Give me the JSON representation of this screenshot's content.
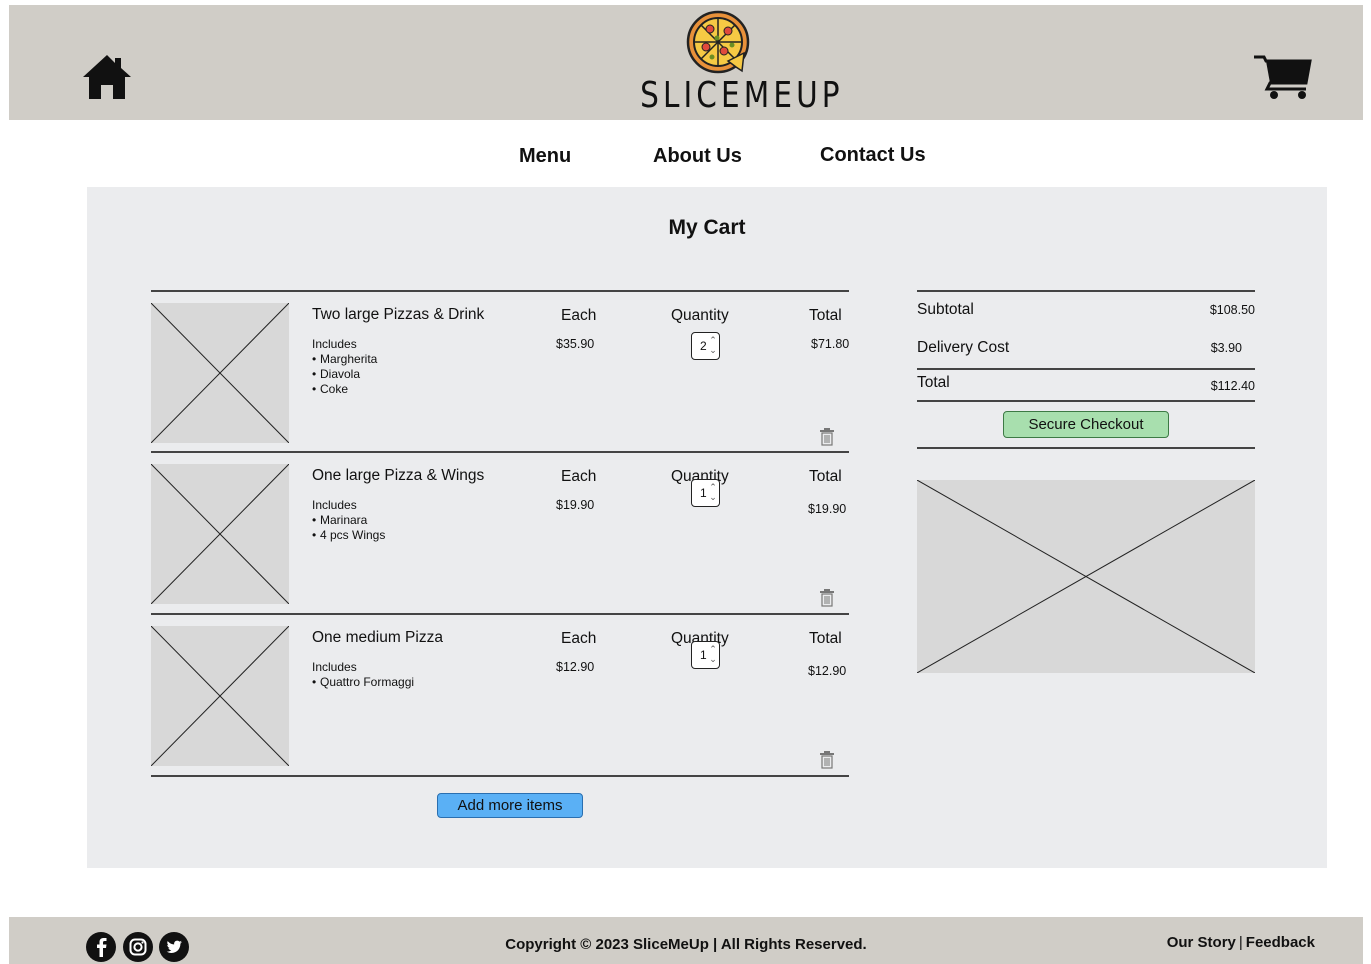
{
  "brand": {
    "name": "SLICEMEUP"
  },
  "header": {
    "home_icon": "home-icon",
    "cart_icon": "shopping-cart-icon"
  },
  "nav": {
    "menu": "Menu",
    "about": "About Us",
    "contact": "Contact Us"
  },
  "cart": {
    "title": "My Cart",
    "columns": {
      "each": "Each",
      "quantity": "Quantity",
      "total": "Total"
    },
    "includes_label": "Includes",
    "items": [
      {
        "name": "Two large Pizzas & Drink",
        "includes": [
          "Margherita",
          "Diavola",
          "Coke"
        ],
        "each": "$35.90",
        "quantity": "2",
        "total": "$71.80"
      },
      {
        "name": "One large Pizza & Wings",
        "includes": [
          "Marinara",
          "4 pcs Wings"
        ],
        "each": "$19.90",
        "quantity": "1",
        "total": "$19.90"
      },
      {
        "name": "One medium Pizza",
        "includes": [
          "Quattro Formaggi"
        ],
        "each": "$12.90",
        "quantity": "1",
        "total": "$12.90"
      }
    ],
    "add_more_label": "Add more items"
  },
  "summary": {
    "subtotal_label": "Subtotal",
    "subtotal": "$108.50",
    "delivery_label": "Delivery Cost",
    "delivery": "$3.90",
    "total_label": "Total",
    "total": "$112.40",
    "checkout_label": "Secure Checkout"
  },
  "footer": {
    "copyright": "Copyright © 2023 SliceMeUp | All Rights Reserved.",
    "our_story": "Our Story",
    "separator": "|",
    "feedback": "Feedback",
    "social_icons": [
      "facebook-icon",
      "instagram-icon",
      "twitter-icon"
    ]
  },
  "colors": {
    "header_bg": "#d0cdc7",
    "panel_bg": "#ebecee",
    "add_button": "#5ab0f5",
    "checkout_button": "#a8dfae",
    "placeholder": "#d8d8d8"
  }
}
